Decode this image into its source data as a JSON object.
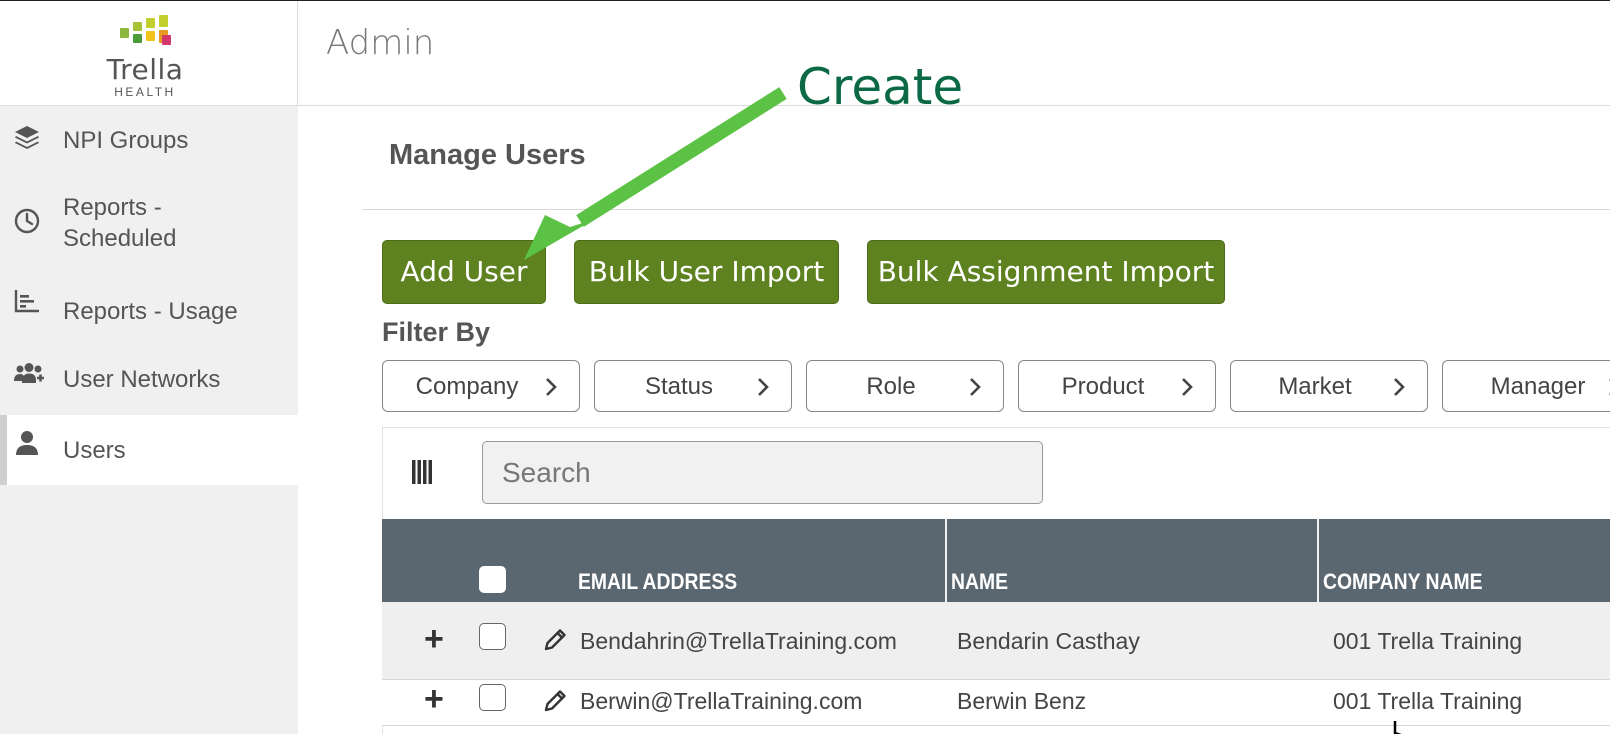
{
  "sidebar": {
    "logo": {
      "name": "Trella",
      "sub": "HEALTH"
    },
    "items": [
      {
        "label": "NPI Groups",
        "icon": "layers-icon"
      },
      {
        "label": "Reports -",
        "label2": "Scheduled",
        "icon": "clock-icon"
      },
      {
        "label": "Reports - Usage",
        "icon": "bar-chart-icon"
      },
      {
        "label": "User Networks",
        "icon": "users-plus-icon"
      },
      {
        "label": "Users",
        "icon": "user-icon",
        "active": true
      }
    ]
  },
  "header": {
    "title": "Admin"
  },
  "main": {
    "title": "Manage Users",
    "buttons": {
      "add_user": "Add User",
      "bulk_user_import": "Bulk User Import",
      "bulk_assignment_import": "Bulk Assignment Import"
    },
    "filter_label": "Filter By",
    "filters": [
      "Company",
      "Status",
      "Role",
      "Product",
      "Market",
      "Manager"
    ],
    "search": {
      "placeholder": "Search",
      "value": ""
    },
    "table": {
      "columns": [
        "EMAIL ADDRESS",
        "NAME",
        "COMPANY NAME"
      ],
      "rows": [
        {
          "email": "Bendahrin@TrellaTraining.com",
          "name": "Bendarin Casthay",
          "company": "001 Trella Training"
        },
        {
          "email": "Berwin@TrellaTraining.com",
          "name": "Berwin Benz",
          "company": "001 Trella Training"
        }
      ]
    }
  },
  "annotation": {
    "text": "Create",
    "color": "#0b6a45",
    "arrow_color": "#5cc245"
  },
  "colors": {
    "button_green": "#5f8220",
    "table_header": "#5b6770",
    "sidebar_bg": "#f0f0f0",
    "logo_squares": [
      "#8cb63c",
      "#c3cf2d",
      "#f2c31b",
      "#e89a1f",
      "#d33a6b"
    ]
  }
}
